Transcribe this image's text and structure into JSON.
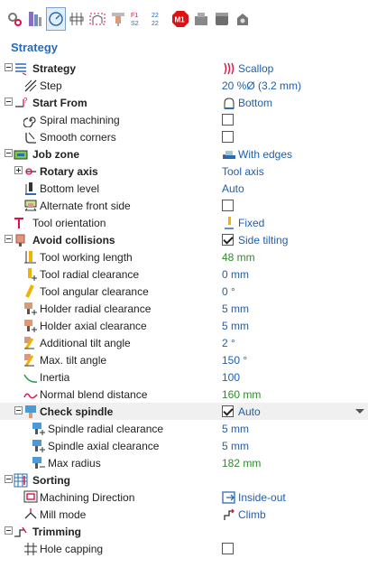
{
  "panel": {
    "title": "Strategy"
  },
  "toolbar": {
    "items": [
      {
        "icon": "settings-gears-icon"
      },
      {
        "icon": "tool-holder-icon"
      },
      {
        "icon": "strategy-gauge-icon"
      },
      {
        "icon": "links-icon"
      },
      {
        "icon": "leads-icon"
      },
      {
        "icon": "feeds-icon"
      },
      {
        "icon": "feeds-speeds-icon",
        "text_top": "F1",
        "text_bottom": "S2"
      },
      {
        "icon": "coolant-icon",
        "text_top": "22",
        "text_bottom": "22"
      },
      {
        "icon": "macro-m1-icon",
        "text": "M1"
      },
      {
        "icon": "stock-icon"
      },
      {
        "icon": "solid-icon"
      },
      {
        "icon": "machine-icon"
      }
    ]
  },
  "rows": [
    {
      "key": "strategy",
      "label": "Strategy",
      "bold": true,
      "value": "Scallop",
      "value_icon": "scallop-icon"
    },
    {
      "key": "step",
      "label": "Step",
      "value": "20 %Ø (3.2 mm)"
    },
    {
      "key": "start_from",
      "label": "Start From",
      "bold": true,
      "value": "Bottom",
      "value_icon": "bottom-icon"
    },
    {
      "key": "spiral_machining",
      "label": "Spiral machining",
      "checkbox": false
    },
    {
      "key": "smooth_corners",
      "label": "Smooth corners",
      "checkbox": false
    },
    {
      "key": "job_zone",
      "label": "Job zone",
      "bold": true,
      "value": "With edges",
      "value_icon": "with-edges-icon"
    },
    {
      "key": "rotary_axis",
      "label": "Rotary axis",
      "bold": true,
      "value": "Tool axis"
    },
    {
      "key": "bottom_level",
      "label": "Bottom level",
      "value": "Auto"
    },
    {
      "key": "alternate_front_side",
      "label": "Alternate front side",
      "checkbox": false
    },
    {
      "key": "tool_orientation",
      "label": "Tool orientation",
      "value": "Fixed",
      "value_icon": "fixed-icon"
    },
    {
      "key": "avoid_collisions",
      "label": "Avoid collisions",
      "bold": true,
      "checkbox": true,
      "value": "Side tilting"
    },
    {
      "key": "tool_working_length",
      "label": "Tool working length",
      "value": "48 mm",
      "green": true
    },
    {
      "key": "tool_radial_clearance",
      "label": "Tool radial clearance",
      "value": "0 mm"
    },
    {
      "key": "tool_angular_clearance",
      "label": "Tool angular clearance",
      "value": "0 °"
    },
    {
      "key": "holder_radial_clearance",
      "label": "Holder radial clearance",
      "value": "5 mm"
    },
    {
      "key": "holder_axial_clearance",
      "label": "Holder axial clearance",
      "value": "5 mm"
    },
    {
      "key": "additional_tilt_angle",
      "label": "Additional tilt angle",
      "value": "2 °"
    },
    {
      "key": "max_tilt_angle",
      "label": "Max. tilt angle",
      "value": "150 °"
    },
    {
      "key": "inertia",
      "label": "Inertia",
      "value": "100"
    },
    {
      "key": "normal_blend_distance",
      "label": "Normal blend distance",
      "value": "160 mm",
      "green": true
    },
    {
      "key": "check_spindle",
      "label": "Check spindle",
      "bold": true,
      "checkbox": true,
      "value": "Auto"
    },
    {
      "key": "spindle_radial_clearance",
      "label": "Spindle radial clearance",
      "value": "5 mm"
    },
    {
      "key": "spindle_axial_clearance",
      "label": "Spindle axial clearance",
      "value": "5 mm"
    },
    {
      "key": "max_radius",
      "label": "Max radius",
      "value": "182 mm",
      "green": true
    },
    {
      "key": "sorting",
      "label": "Sorting",
      "bold": true
    },
    {
      "key": "machining_direction",
      "label": "Machining Direction",
      "value": "Inside-out",
      "value_icon": "inside-out-icon"
    },
    {
      "key": "mill_mode",
      "label": "Mill mode",
      "value": "Climb",
      "value_icon": "climb-icon"
    },
    {
      "key": "trimming",
      "label": "Trimming",
      "bold": true
    },
    {
      "key": "hole_capping",
      "label": "Hole capping",
      "checkbox": false
    }
  ],
  "colors": {
    "accent": "#2a6bb5",
    "value": "#1f5fae",
    "green": "#2e8b2e"
  }
}
